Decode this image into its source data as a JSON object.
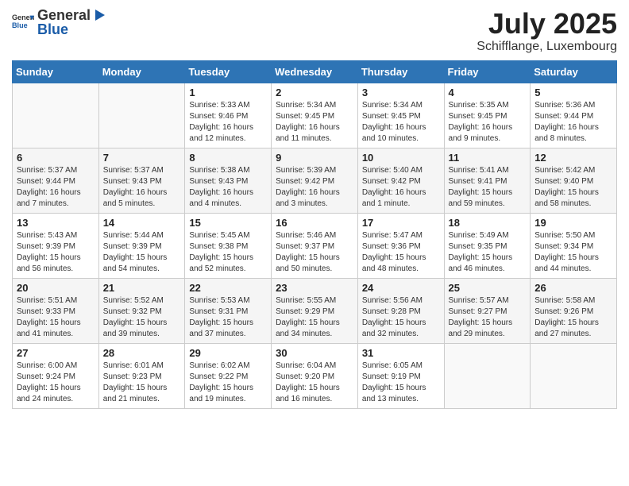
{
  "logo": {
    "text_general": "General",
    "text_blue": "Blue"
  },
  "title": "July 2025",
  "subtitle": "Schifflange, Luxembourg",
  "days_of_week": [
    "Sunday",
    "Monday",
    "Tuesday",
    "Wednesday",
    "Thursday",
    "Friday",
    "Saturday"
  ],
  "weeks": [
    [
      {
        "day": "",
        "info": ""
      },
      {
        "day": "",
        "info": ""
      },
      {
        "day": "1",
        "info": "Sunrise: 5:33 AM\nSunset: 9:46 PM\nDaylight: 16 hours and 12 minutes."
      },
      {
        "day": "2",
        "info": "Sunrise: 5:34 AM\nSunset: 9:45 PM\nDaylight: 16 hours and 11 minutes."
      },
      {
        "day": "3",
        "info": "Sunrise: 5:34 AM\nSunset: 9:45 PM\nDaylight: 16 hours and 10 minutes."
      },
      {
        "day": "4",
        "info": "Sunrise: 5:35 AM\nSunset: 9:45 PM\nDaylight: 16 hours and 9 minutes."
      },
      {
        "day": "5",
        "info": "Sunrise: 5:36 AM\nSunset: 9:44 PM\nDaylight: 16 hours and 8 minutes."
      }
    ],
    [
      {
        "day": "6",
        "info": "Sunrise: 5:37 AM\nSunset: 9:44 PM\nDaylight: 16 hours and 7 minutes."
      },
      {
        "day": "7",
        "info": "Sunrise: 5:37 AM\nSunset: 9:43 PM\nDaylight: 16 hours and 5 minutes."
      },
      {
        "day": "8",
        "info": "Sunrise: 5:38 AM\nSunset: 9:43 PM\nDaylight: 16 hours and 4 minutes."
      },
      {
        "day": "9",
        "info": "Sunrise: 5:39 AM\nSunset: 9:42 PM\nDaylight: 16 hours and 3 minutes."
      },
      {
        "day": "10",
        "info": "Sunrise: 5:40 AM\nSunset: 9:42 PM\nDaylight: 16 hours and 1 minute."
      },
      {
        "day": "11",
        "info": "Sunrise: 5:41 AM\nSunset: 9:41 PM\nDaylight: 15 hours and 59 minutes."
      },
      {
        "day": "12",
        "info": "Sunrise: 5:42 AM\nSunset: 9:40 PM\nDaylight: 15 hours and 58 minutes."
      }
    ],
    [
      {
        "day": "13",
        "info": "Sunrise: 5:43 AM\nSunset: 9:39 PM\nDaylight: 15 hours and 56 minutes."
      },
      {
        "day": "14",
        "info": "Sunrise: 5:44 AM\nSunset: 9:39 PM\nDaylight: 15 hours and 54 minutes."
      },
      {
        "day": "15",
        "info": "Sunrise: 5:45 AM\nSunset: 9:38 PM\nDaylight: 15 hours and 52 minutes."
      },
      {
        "day": "16",
        "info": "Sunrise: 5:46 AM\nSunset: 9:37 PM\nDaylight: 15 hours and 50 minutes."
      },
      {
        "day": "17",
        "info": "Sunrise: 5:47 AM\nSunset: 9:36 PM\nDaylight: 15 hours and 48 minutes."
      },
      {
        "day": "18",
        "info": "Sunrise: 5:49 AM\nSunset: 9:35 PM\nDaylight: 15 hours and 46 minutes."
      },
      {
        "day": "19",
        "info": "Sunrise: 5:50 AM\nSunset: 9:34 PM\nDaylight: 15 hours and 44 minutes."
      }
    ],
    [
      {
        "day": "20",
        "info": "Sunrise: 5:51 AM\nSunset: 9:33 PM\nDaylight: 15 hours and 41 minutes."
      },
      {
        "day": "21",
        "info": "Sunrise: 5:52 AM\nSunset: 9:32 PM\nDaylight: 15 hours and 39 minutes."
      },
      {
        "day": "22",
        "info": "Sunrise: 5:53 AM\nSunset: 9:31 PM\nDaylight: 15 hours and 37 minutes."
      },
      {
        "day": "23",
        "info": "Sunrise: 5:55 AM\nSunset: 9:29 PM\nDaylight: 15 hours and 34 minutes."
      },
      {
        "day": "24",
        "info": "Sunrise: 5:56 AM\nSunset: 9:28 PM\nDaylight: 15 hours and 32 minutes."
      },
      {
        "day": "25",
        "info": "Sunrise: 5:57 AM\nSunset: 9:27 PM\nDaylight: 15 hours and 29 minutes."
      },
      {
        "day": "26",
        "info": "Sunrise: 5:58 AM\nSunset: 9:26 PM\nDaylight: 15 hours and 27 minutes."
      }
    ],
    [
      {
        "day": "27",
        "info": "Sunrise: 6:00 AM\nSunset: 9:24 PM\nDaylight: 15 hours and 24 minutes."
      },
      {
        "day": "28",
        "info": "Sunrise: 6:01 AM\nSunset: 9:23 PM\nDaylight: 15 hours and 21 minutes."
      },
      {
        "day": "29",
        "info": "Sunrise: 6:02 AM\nSunset: 9:22 PM\nDaylight: 15 hours and 19 minutes."
      },
      {
        "day": "30",
        "info": "Sunrise: 6:04 AM\nSunset: 9:20 PM\nDaylight: 15 hours and 16 minutes."
      },
      {
        "day": "31",
        "info": "Sunrise: 6:05 AM\nSunset: 9:19 PM\nDaylight: 15 hours and 13 minutes."
      },
      {
        "day": "",
        "info": ""
      },
      {
        "day": "",
        "info": ""
      }
    ]
  ]
}
